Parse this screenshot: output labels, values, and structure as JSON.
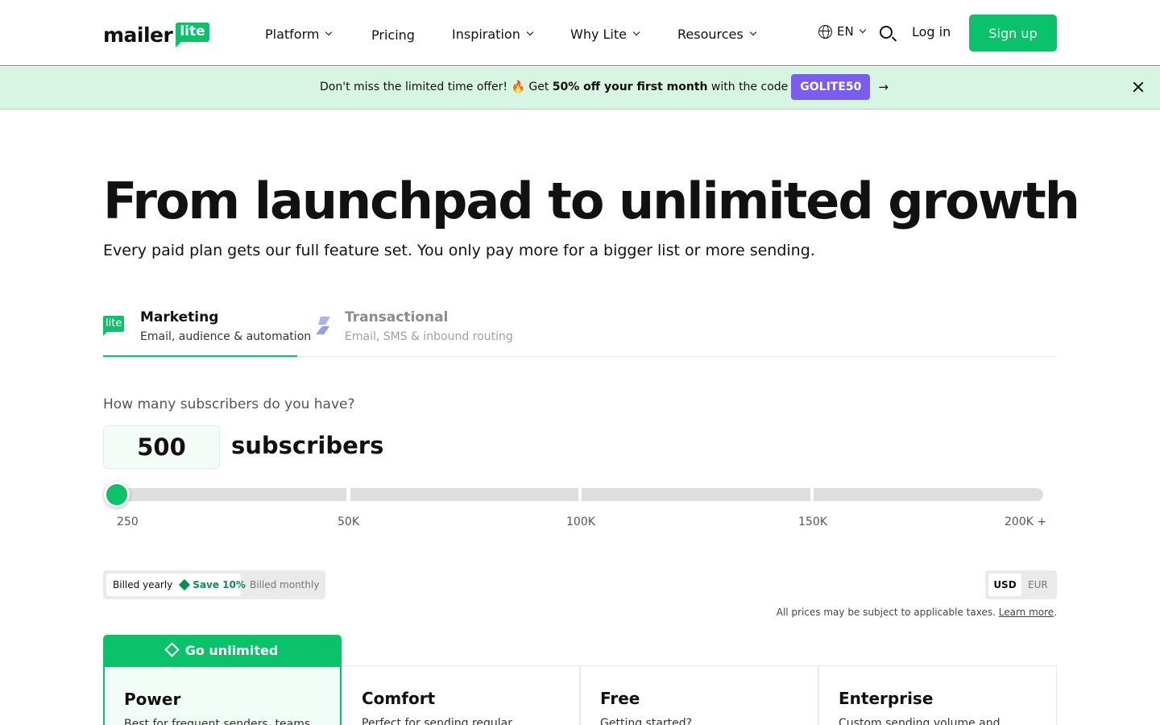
{
  "brand": {
    "wordmark": "mailer",
    "badge": "lite",
    "accent": "#09c269"
  },
  "nav": [
    {
      "label": "Platform",
      "has_menu": true
    },
    {
      "label": "Pricing",
      "has_menu": false
    },
    {
      "label": "Inspiration",
      "has_menu": true
    },
    {
      "label": "Why Lite",
      "has_menu": true
    },
    {
      "label": "Resources",
      "has_menu": true
    }
  ],
  "header": {
    "lang": "EN",
    "login": "Log in",
    "signup": "Sign up"
  },
  "promo": {
    "text_before": "Don't miss the limited time offer! 🔥 Get ",
    "highlight": "50% off your first month",
    "text_after": " with the code",
    "code": "GOLITE50",
    "arrow": "→",
    "code_color": "#7b5cf0"
  },
  "hero": {
    "title": "From launchpad to unlimited growth",
    "subtitle": "Every paid plan gets our full feature set. You only pay more for a bigger list or more sending."
  },
  "tabs": [
    {
      "title": "Marketing",
      "desc": "Email, audience & automation",
      "icon": "lite",
      "active": true
    },
    {
      "title": "Transactional",
      "desc": "Email, SMS & inbound routing",
      "icon": "bolt-icon",
      "active": false
    }
  ],
  "subscribers": {
    "question": "How many subscribers do you have?",
    "value": "500",
    "unit": "subscribers",
    "ticks": [
      "250",
      "50K",
      "100K",
      "150K",
      "200K +"
    ]
  },
  "billing": {
    "yearly": "Billed yearly",
    "save": "Save 10%",
    "monthly": "Billed monthly",
    "currency_usd": "USD",
    "currency_eur": "EUR",
    "tax_note": "All prices may be subject to applicable taxes.",
    "learn_more": "Learn more",
    "tax_suffix": "."
  },
  "plans": {
    "unlimited_label": "Go unlimited",
    "cards": [
      {
        "title": "Power",
        "desc": "Best for frequent senders, teams"
      },
      {
        "title": "Comfort",
        "desc": "Perfect for sending regular"
      },
      {
        "title": "Free",
        "desc": "Getting started?"
      },
      {
        "title": "Enterprise",
        "desc": "Custom sending volume and"
      }
    ]
  }
}
